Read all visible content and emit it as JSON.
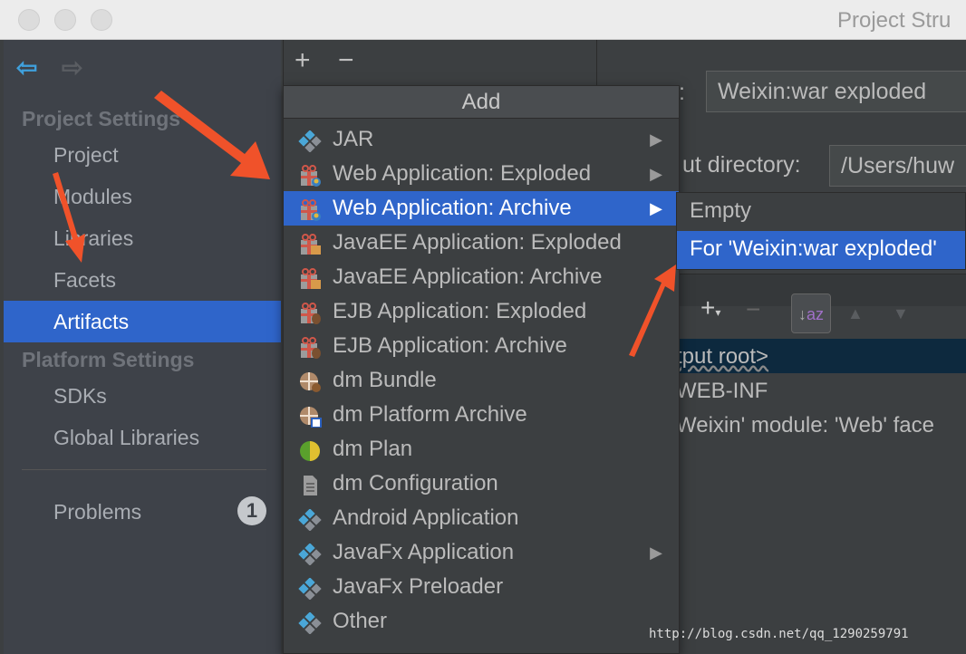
{
  "window": {
    "title": "Project Stru"
  },
  "sidebar": {
    "sections": [
      {
        "label": "Project Settings"
      },
      {
        "label": "Platform Settings"
      }
    ],
    "items": [
      {
        "label": "Project"
      },
      {
        "label": "Modules"
      },
      {
        "label": "Libraries"
      },
      {
        "label": "Facets"
      },
      {
        "label": "Artifacts",
        "selected": true
      },
      {
        "label": "SDKs"
      },
      {
        "label": "Global Libraries"
      },
      {
        "label": "Problems",
        "badge": "1"
      }
    ]
  },
  "toolbar": {
    "add": "+",
    "remove": "−"
  },
  "detail": {
    "name_label_fragment": ":",
    "name_value": "Weixin:war exploded",
    "output_dir_label": "ut directory:",
    "output_dir_value": "/Users/huw",
    "tree": [
      "tput root>",
      "WEB-INF",
      "Weixin' module: 'Web' face"
    ]
  },
  "popup": {
    "title": "Add",
    "items": [
      {
        "label": "JAR",
        "icon": "jar-icon",
        "submenu": true
      },
      {
        "label": "Web Application: Exploded",
        "icon": "web-app-icon",
        "submenu": true
      },
      {
        "label": "Web Application: Archive",
        "icon": "web-app-icon",
        "submenu": true,
        "selected": true
      },
      {
        "label": "JavaEE Application: Exploded",
        "icon": "javaee-icon"
      },
      {
        "label": "JavaEE Application: Archive",
        "icon": "javaee-icon"
      },
      {
        "label": "EJB Application: Exploded",
        "icon": "ejb-icon"
      },
      {
        "label": "EJB Application: Archive",
        "icon": "ejb-icon"
      },
      {
        "label": "dm Bundle",
        "icon": "dm-bundle-icon"
      },
      {
        "label": "dm Platform Archive",
        "icon": "dm-platform-icon"
      },
      {
        "label": "dm Plan",
        "icon": "dm-plan-icon"
      },
      {
        "label": "dm Configuration",
        "icon": "file-icon"
      },
      {
        "label": "Android Application",
        "icon": "jar-icon"
      },
      {
        "label": "JavaFx Application",
        "icon": "jar-icon",
        "submenu": true
      },
      {
        "label": "JavaFx Preloader",
        "icon": "jar-icon"
      },
      {
        "label": "Other",
        "icon": "jar-icon"
      }
    ]
  },
  "submenu": {
    "items": [
      {
        "label": "Empty"
      },
      {
        "label": "For 'Weixin:war exploded'",
        "selected": true
      }
    ]
  },
  "watermark": "http://blog.csdn.net/qq_1290259791",
  "colors": {
    "accent": "#2f65ca",
    "annotation_arrow": "#f0522a"
  }
}
